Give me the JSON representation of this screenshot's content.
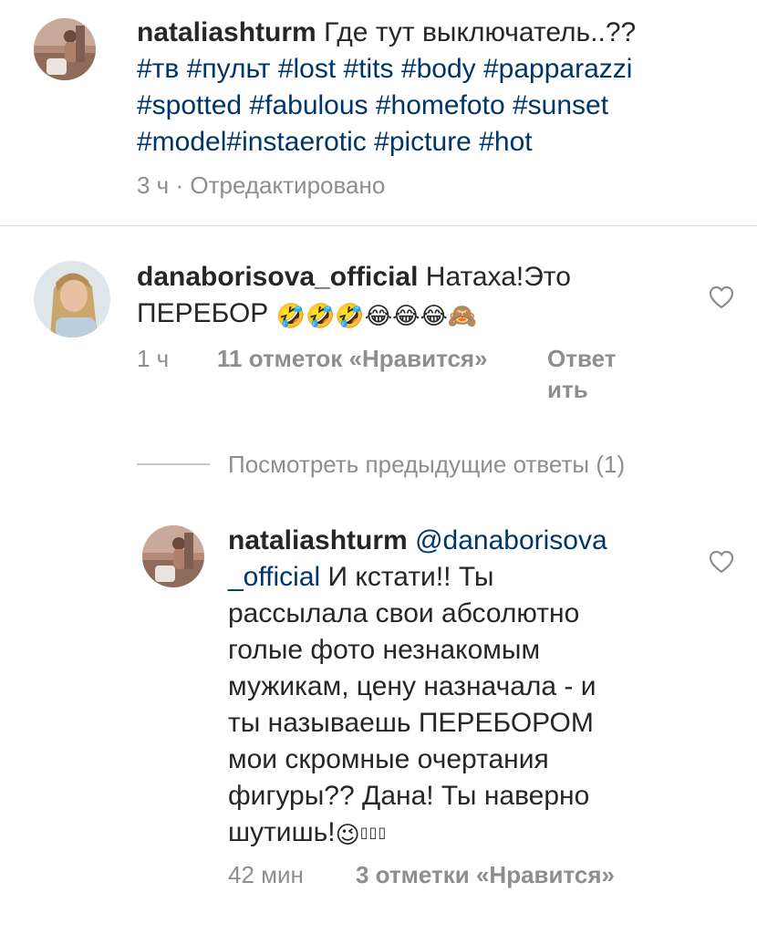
{
  "post": {
    "username": "nataliashturm",
    "caption": "Где тут выключатель..??",
    "hashtags_line1": "#тв #пульт #lost #tits #body #papparazzi",
    "hashtags_line2": "#spotted #fabulous #homefoto #sunset",
    "hashtags_line3": "#model#instaerotic #picture #hot",
    "time": "3 ч",
    "separator": "·",
    "edited": "Отредактировано"
  },
  "comments": [
    {
      "username": "danaborisova_official",
      "text_line1": "Натаха!Это",
      "text_line2": "ПЕРЕБОР",
      "emoji": "🤣🤣🤣😂😂😂🙈",
      "time": "1 ч",
      "likes": "11 отметок «Нравится»",
      "reply_line1": "Ответ",
      "reply_line2": "ить",
      "like_icon": "heart-outline-icon"
    }
  ],
  "view_previous": "Посмотреть предыдущие ответы (1)",
  "reply": {
    "username": "nataliashturm",
    "mention_line1": "@danaborisova",
    "mention_line2": "_official",
    "lines": [
      "И кстати!! Ты",
      "рассылала свои абсолютно",
      "голые фото незнакомым",
      "мужикам, цену назначала - и",
      "ты называешь ПЕРЕБОРОМ",
      "мои скромные очертания",
      "фигуры?? Дана! Ты наверно",
      "шутишь!"
    ],
    "emoji": "😉",
    "missing_glyphs": "▯▯▯",
    "time": "42 мин",
    "likes": "3 отметки «Нравится»",
    "like_icon": "heart-outline-icon"
  },
  "colors": {
    "text": "#262626",
    "secondary": "#8e8e8e",
    "hashtag": "#003569",
    "divider": "#dbdbdb"
  }
}
